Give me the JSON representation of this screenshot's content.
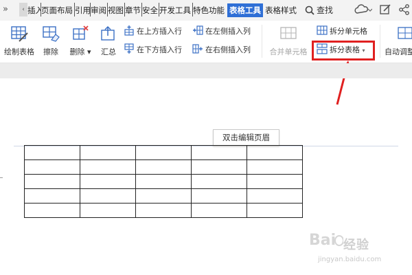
{
  "tabs": [
    {
      "label": "插入"
    },
    {
      "label": "页面布局"
    },
    {
      "label": "引用"
    },
    {
      "label": "审阅"
    },
    {
      "label": "视图"
    },
    {
      "label": "章节"
    },
    {
      "label": "安全"
    },
    {
      "label": "开发工具"
    },
    {
      "label": "特色功能"
    },
    {
      "label": "表格工具"
    },
    {
      "label": "表格样式"
    }
  ],
  "search_label": "查找",
  "ribbon": {
    "draw_table": "绘制表格",
    "erase": "擦除",
    "delete": "删除",
    "summary": "汇总",
    "insert_above": "在上方插入行",
    "insert_below": "在下方插入行",
    "insert_left": "在左侧插入列",
    "insert_right": "在右侧插入列",
    "merge_cells": "合并单元格",
    "split_cells": "拆分单元格",
    "split_table": "拆分表格",
    "auto_fit": "自动调整"
  },
  "document": {
    "header_tip": "双击编辑页眉",
    "table_rows": 5,
    "table_cols": 5
  },
  "watermark": {
    "text": "经验",
    "url": "jingyan.baidu.com"
  },
  "colors": {
    "active_tab": "#2f6fd6",
    "highlight": "#e02020"
  }
}
